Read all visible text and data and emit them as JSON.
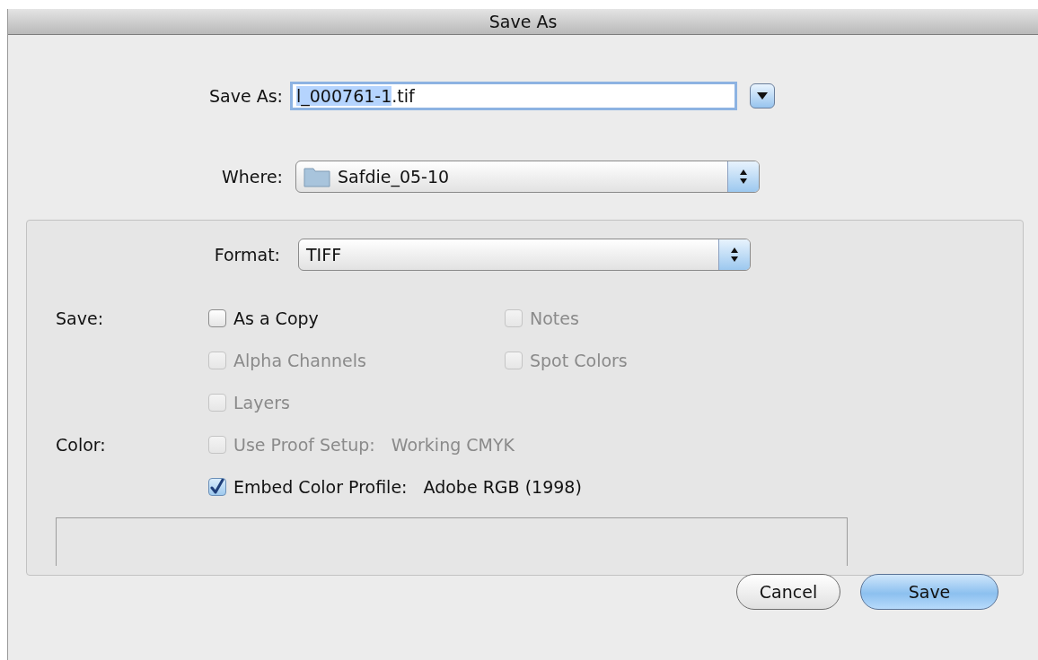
{
  "window": {
    "title": "Save As"
  },
  "save_as": {
    "label": "Save As:",
    "value_selected": "l_000761-1",
    "value_rest": ".tif"
  },
  "where": {
    "label": "Where:",
    "value": "Safdie_05-10"
  },
  "format": {
    "label": "Format:",
    "value": "TIFF"
  },
  "save_group": {
    "label": "Save:",
    "options": [
      {
        "label": "As a Copy",
        "checked": false,
        "disabled": false
      },
      {
        "label": "Notes",
        "checked": false,
        "disabled": true
      },
      {
        "label": "Alpha Channels",
        "checked": false,
        "disabled": true
      },
      {
        "label": "Spot Colors",
        "checked": false,
        "disabled": true
      },
      {
        "label": "Layers",
        "checked": false,
        "disabled": true
      }
    ]
  },
  "color_group": {
    "label": "Color:",
    "options": [
      {
        "label": "Use Proof Setup:",
        "value": "Working CMYK",
        "checked": false,
        "disabled": true
      },
      {
        "label": "Embed Color Profile:",
        "value": "Adobe RGB (1998)",
        "checked": true,
        "disabled": false
      }
    ]
  },
  "buttons": [
    {
      "label": "Cancel",
      "kind": "secondary"
    },
    {
      "label": "Save",
      "kind": "default"
    }
  ]
}
